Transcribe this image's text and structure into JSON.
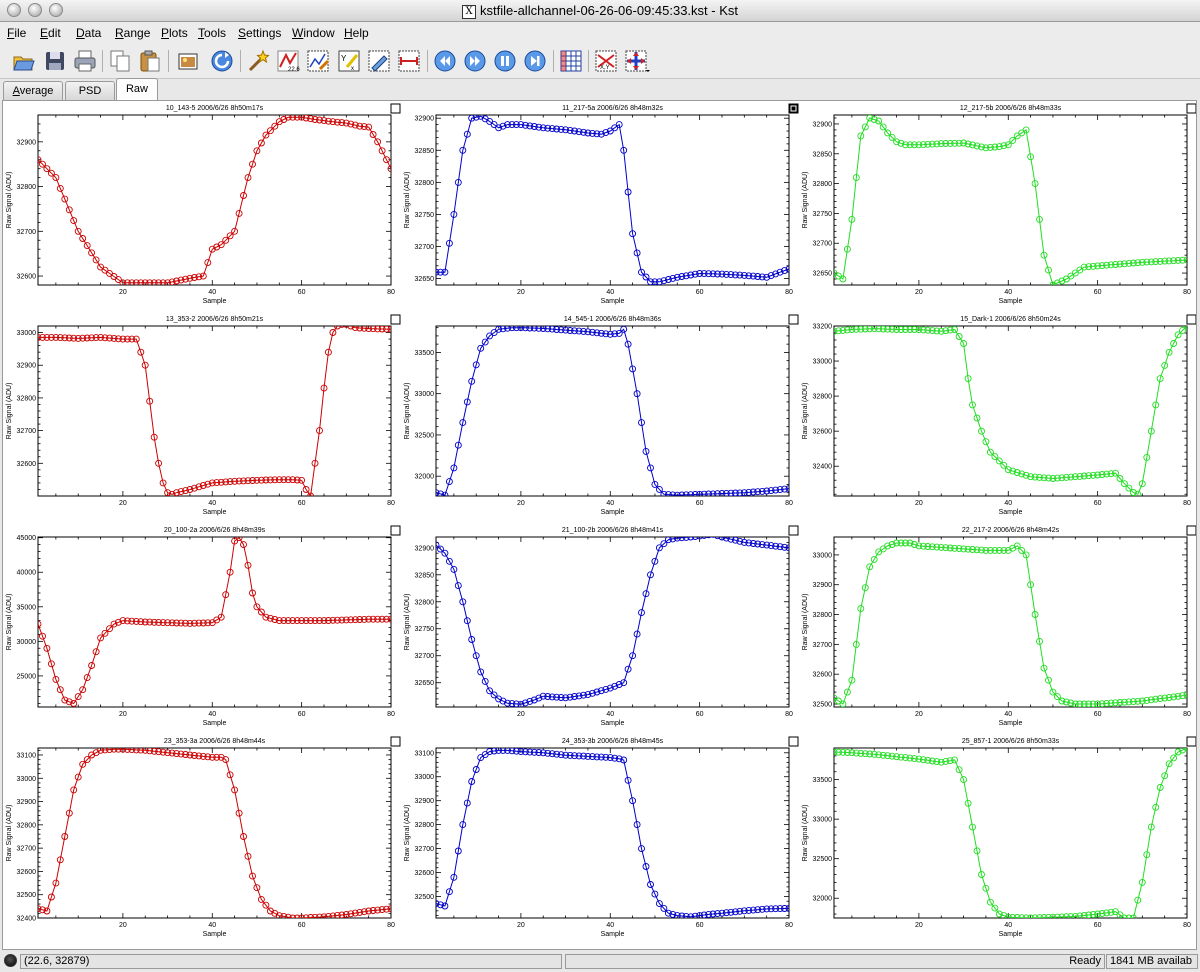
{
  "window": {
    "title": "kstfile-allchannel-06-26-06-09:45:33.kst - Kst"
  },
  "menu": [
    "File",
    "Edit",
    "Data",
    "Range",
    "Plots",
    "Tools",
    "Settings",
    "Window",
    "Help"
  ],
  "toolbar_icons": [
    "open-icon",
    "save-icon",
    "print-icon",
    "copy-icon",
    "paste-icon",
    "export-image-icon",
    "reload-icon",
    "data-wizard-icon",
    "plugin-icon",
    "edit-plot-icon",
    "equation-icon",
    "histogram-icon",
    "spectrum-icon",
    "back-icon",
    "forward-icon",
    "pause-icon",
    "end-icon",
    "grid-layout-icon",
    "xy-zoom-icon",
    "layout-mode-icon"
  ],
  "tabs": [
    "Average",
    "PSD",
    "Raw"
  ],
  "active_tab": "Raw",
  "status": {
    "coords": "(22.6, 32879)",
    "state": "Ready",
    "memory": "1841 MB availab"
  },
  "colors": {
    "red": "#cc0000",
    "blue": "#0000cc",
    "green": "#22dd22"
  },
  "chart_data": [
    {
      "type": "line",
      "title": "10_143-5 2006/6/26 8h50m17s",
      "xlabel": "Sample",
      "ylabel": "Raw Signal (ADU)",
      "color": "red",
      "xlim": [
        1,
        80
      ],
      "ylim": [
        32580,
        32960
      ],
      "yticks": [
        32600,
        32700,
        32800,
        32900
      ],
      "xticks": [
        20,
        40,
        60,
        80
      ],
      "checked": false,
      "x": [
        1,
        5,
        10,
        15,
        20,
        25,
        30,
        35,
        38,
        40,
        42,
        45,
        48,
        50,
        52,
        55,
        57,
        60,
        63,
        67,
        70,
        73,
        75,
        77,
        78,
        80
      ],
      "y": [
        32860,
        32820,
        32700,
        32620,
        32585,
        32585,
        32585,
        32595,
        32600,
        32660,
        32670,
        32700,
        32820,
        32880,
        32915,
        32945,
        32955,
        32955,
        32950,
        32945,
        32942,
        32935,
        32933,
        32900,
        32880,
        32840
      ]
    },
    {
      "type": "line",
      "title": "11_217-5a 2006/6/26 8h48m32s",
      "xlabel": "Sample",
      "ylabel": "Raw Signal (ADU)",
      "color": "blue",
      "xlim": [
        1,
        80
      ],
      "ylim": [
        32640,
        32905
      ],
      "yticks": [
        32650,
        32700,
        32750,
        32800,
        32850,
        32900
      ],
      "xticks": [
        20,
        40,
        60,
        80
      ],
      "checked": true,
      "x": [
        1,
        3,
        5,
        7,
        9,
        11,
        13,
        15,
        17,
        20,
        25,
        30,
        35,
        38,
        40,
        42,
        43,
        45,
        47,
        49,
        51,
        55,
        60,
        65,
        70,
        75,
        78,
        80
      ],
      "y": [
        32660,
        32660,
        32750,
        32850,
        32900,
        32903,
        32895,
        32885,
        32890,
        32890,
        32885,
        32882,
        32877,
        32875,
        32880,
        32890,
        32850,
        32720,
        32660,
        32645,
        32645,
        32652,
        32658,
        32657,
        32655,
        32652,
        32660,
        32665
      ]
    },
    {
      "type": "line",
      "title": "12_217-5b 2006/6/26 8h48m33s",
      "xlabel": "Sample",
      "ylabel": "Raw Signal (ADU)",
      "color": "green",
      "xlim": [
        1,
        80
      ],
      "ylim": [
        32630,
        32915
      ],
      "yticks": [
        32650,
        32700,
        32750,
        32800,
        32850,
        32900
      ],
      "xticks": [
        20,
        40,
        60,
        80
      ],
      "checked": false,
      "x": [
        1,
        3,
        5,
        7,
        9,
        11,
        13,
        15,
        17,
        20,
        25,
        30,
        35,
        38,
        40,
        42,
        44,
        46,
        48,
        50,
        53,
        57,
        60,
        65,
        70,
        75,
        80
      ],
      "y": [
        32650,
        32640,
        32740,
        32880,
        32910,
        32905,
        32885,
        32870,
        32865,
        32865,
        32867,
        32868,
        32860,
        32862,
        32865,
        32880,
        32890,
        32800,
        32680,
        32630,
        32640,
        32660,
        32662,
        32665,
        32668,
        32670,
        32672
      ]
    },
    {
      "type": "line",
      "title": "13_353-2 2006/6/26 8h50m21s",
      "xlabel": "Sample",
      "ylabel": "Raw Signal (ADU)",
      "color": "red",
      "xlim": [
        1,
        80
      ],
      "ylim": [
        32500,
        33020
      ],
      "yticks": [
        32600,
        32700,
        32800,
        32900,
        33000
      ],
      "xticks": [
        20,
        40,
        60,
        80
      ],
      "checked": false,
      "x": [
        1,
        5,
        10,
        15,
        20,
        23,
        25,
        26,
        27,
        28,
        29,
        30,
        31,
        32,
        35,
        40,
        45,
        50,
        55,
        58,
        60,
        61,
        62,
        63,
        64,
        65,
        66,
        67,
        68,
        69,
        70,
        72,
        75,
        80
      ],
      "y": [
        32985,
        32985,
        32982,
        32985,
        32980,
        32980,
        32900,
        32790,
        32680,
        32600,
        32540,
        32510,
        32505,
        32510,
        32520,
        32540,
        32545,
        32548,
        32550,
        32550,
        32548,
        32520,
        32500,
        32600,
        32700,
        32830,
        32940,
        33000,
        33020,
        33025,
        33025,
        33015,
        33012,
        33010
      ]
    },
    {
      "type": "line",
      "title": "14_545-1 2006/6/26 8h48m36s",
      "xlabel": "Sample",
      "ylabel": "Raw Signal (ADU)",
      "color": "blue",
      "xlim": [
        1,
        80
      ],
      "ylim": [
        31760,
        33820
      ],
      "yticks": [
        32000,
        32500,
        33000,
        33500
      ],
      "xticks": [
        20,
        40,
        60,
        80
      ],
      "checked": false,
      "x": [
        1,
        3,
        5,
        7,
        9,
        11,
        13,
        15,
        18,
        20,
        25,
        30,
        35,
        40,
        42,
        43,
        44,
        46,
        48,
        50,
        52,
        55,
        60,
        65,
        70,
        75,
        80
      ],
      "y": [
        31800,
        31770,
        32100,
        32650,
        33150,
        33550,
        33700,
        33780,
        33800,
        33800,
        33790,
        33770,
        33750,
        33720,
        33730,
        33780,
        33600,
        33000,
        32300,
        31900,
        31780,
        31770,
        31780,
        31790,
        31800,
        31820,
        31850
      ]
    },
    {
      "type": "line",
      "title": "15_Dark-1 2006/6/26 8h50m24s",
      "xlabel": "Sample",
      "ylabel": "Raw Signal (ADU)",
      "color": "green",
      "xlim": [
        1,
        80
      ],
      "ylim": [
        32230,
        33200
      ],
      "yticks": [
        32400,
        32600,
        32800,
        33000,
        33200
      ],
      "xticks": [
        20,
        40,
        60,
        80
      ],
      "checked": false,
      "x": [
        1,
        5,
        10,
        15,
        20,
        25,
        28,
        30,
        31,
        32,
        34,
        36,
        40,
        45,
        50,
        55,
        60,
        64,
        66,
        68,
        69,
        70,
        72,
        74,
        76,
        78,
        80
      ],
      "y": [
        33170,
        33180,
        33185,
        33180,
        33180,
        33170,
        33180,
        33100,
        32900,
        32750,
        32600,
        32480,
        32380,
        32340,
        32330,
        32340,
        32350,
        32360,
        32300,
        32250,
        32240,
        32300,
        32600,
        32900,
        33050,
        33150,
        33200
      ]
    },
    {
      "type": "line",
      "title": "20_100-2a 2006/6/26 8h48m39s",
      "xlabel": "Sample",
      "ylabel": "Raw Signal (ADU)",
      "color": "red",
      "xlim": [
        1,
        80
      ],
      "ylim": [
        20500,
        45100
      ],
      "yticks": [
        25000,
        30000,
        35000,
        40000,
        45000
      ],
      "xticks": [
        20,
        40,
        60,
        80
      ],
      "checked": false,
      "x": [
        1,
        3,
        5,
        7,
        9,
        11,
        13,
        15,
        18,
        20,
        25,
        30,
        35,
        40,
        42,
        44,
        45,
        46,
        47,
        48,
        49,
        50,
        52,
        55,
        60,
        65,
        70,
        75,
        80
      ],
      "y": [
        32500,
        29000,
        24500,
        21500,
        21000,
        23000,
        26500,
        30500,
        32500,
        33000,
        32800,
        32700,
        32600,
        32700,
        33500,
        40000,
        44500,
        45000,
        44000,
        41000,
        37000,
        35000,
        33500,
        33000,
        33000,
        33000,
        33100,
        33200,
        33200
      ]
    },
    {
      "type": "line",
      "title": "21_100-2b 2006/6/26 8h48m41s",
      "xlabel": "Sample",
      "ylabel": "Raw Signal (ADU)",
      "color": "blue",
      "xlim": [
        1,
        80
      ],
      "ylim": [
        32605,
        32920
      ],
      "yticks": [
        32650,
        32700,
        32750,
        32800,
        32850,
        32900
      ],
      "xticks": [
        20,
        40,
        60,
        80
      ],
      "checked": false,
      "x": [
        1,
        3,
        5,
        7,
        9,
        11,
        13,
        15,
        17,
        20,
        23,
        25,
        30,
        35,
        40,
        43,
        45,
        47,
        49,
        51,
        53,
        55,
        58,
        60,
        63,
        65,
        70,
        75,
        80
      ],
      "y": [
        32905,
        32890,
        32860,
        32800,
        32730,
        32670,
        32635,
        32620,
        32612,
        32610,
        32618,
        32625,
        32622,
        32628,
        32640,
        32650,
        32700,
        32780,
        32850,
        32900,
        32915,
        32918,
        32920,
        32922,
        32925,
        32920,
        32910,
        32905,
        32900
      ]
    },
    {
      "type": "line",
      "title": "22_217-2 2006/6/26 8h48m42s",
      "xlabel": "Sample",
      "ylabel": "Raw Signal (ADU)",
      "color": "green",
      "xlim": [
        1,
        80
      ],
      "ylim": [
        32490,
        33060
      ],
      "yticks": [
        32500,
        32600,
        32700,
        32800,
        32900,
        33000
      ],
      "xticks": [
        20,
        40,
        60,
        80
      ],
      "checked": false,
      "x": [
        1,
        3,
        5,
        7,
        9,
        11,
        13,
        15,
        18,
        20,
        25,
        30,
        35,
        40,
        42,
        44,
        46,
        48,
        50,
        52,
        55,
        60,
        65,
        70,
        75,
        80
      ],
      "y": [
        32520,
        32500,
        32580,
        32820,
        32960,
        33010,
        33030,
        33040,
        33040,
        33030,
        33025,
        33020,
        33015,
        33015,
        33030,
        33000,
        32800,
        32620,
        32540,
        32510,
        32500,
        32500,
        32505,
        32510,
        32520,
        32530
      ]
    },
    {
      "type": "line",
      "title": "23_353-3a 2006/6/26 8h48m44s",
      "xlabel": "Sample",
      "ylabel": "Raw Signal (ADU)",
      "color": "red",
      "xlim": [
        1,
        80
      ],
      "ylim": [
        32400,
        33130
      ],
      "yticks": [
        32400,
        32500,
        32600,
        32700,
        32800,
        32900,
        33000,
        33100
      ],
      "xticks": [
        20,
        40,
        60,
        80
      ],
      "checked": false,
      "x": [
        1,
        3,
        5,
        7,
        9,
        11,
        13,
        15,
        18,
        20,
        25,
        30,
        35,
        40,
        42,
        43,
        45,
        47,
        49,
        51,
        53,
        55,
        58,
        60,
        65,
        70,
        75,
        80
      ],
      "y": [
        32440,
        32430,
        32550,
        32750,
        32950,
        33060,
        33100,
        33120,
        33125,
        33125,
        33120,
        33110,
        33100,
        33090,
        33090,
        33080,
        32950,
        32750,
        32580,
        32480,
        32430,
        32410,
        32400,
        32400,
        32405,
        32415,
        32430,
        32440
      ]
    },
    {
      "type": "line",
      "title": "24_353-3b 2006/6/26 8h48m45s",
      "xlabel": "Sample",
      "ylabel": "Raw Signal (ADU)",
      "color": "blue",
      "xlim": [
        1,
        80
      ],
      "ylim": [
        32410,
        33120
      ],
      "yticks": [
        32500,
        32600,
        32700,
        32800,
        32900,
        33000,
        33100
      ],
      "xticks": [
        20,
        40,
        60,
        80
      ],
      "checked": false,
      "x": [
        1,
        3,
        5,
        7,
        9,
        11,
        13,
        15,
        17,
        20,
        25,
        30,
        35,
        40,
        42,
        43,
        45,
        47,
        49,
        51,
        53,
        55,
        58,
        60,
        62,
        65,
        70,
        75,
        80
      ],
      "y": [
        32470,
        32460,
        32580,
        32800,
        32980,
        33080,
        33105,
        33110,
        33110,
        33105,
        33100,
        33090,
        33085,
        33080,
        33075,
        33070,
        32900,
        32700,
        32550,
        32470,
        32430,
        32420,
        32415,
        32420,
        32425,
        32430,
        32440,
        32448,
        32450
      ]
    },
    {
      "type": "line",
      "title": "25_857-1 2006/6/26 8h50m33s",
      "xlabel": "Sample",
      "ylabel": "Raw Signal (ADU)",
      "color": "green",
      "xlim": [
        1,
        80
      ],
      "ylim": [
        31750,
        33900
      ],
      "yticks": [
        32000,
        32500,
        33000,
        33500
      ],
      "xticks": [
        20,
        40,
        60,
        80
      ],
      "checked": false,
      "x": [
        1,
        5,
        10,
        15,
        20,
        25,
        28,
        30,
        32,
        34,
        36,
        38,
        40,
        45,
        50,
        55,
        60,
        64,
        66,
        68,
        70,
        72,
        74,
        76,
        78,
        80
      ],
      "y": [
        33850,
        33840,
        33820,
        33790,
        33760,
        33720,
        33750,
        33500,
        32900,
        32300,
        31950,
        31800,
        31760,
        31750,
        31760,
        31770,
        31800,
        31830,
        31750,
        31750,
        32200,
        32900,
        33400,
        33700,
        33850,
        33900
      ]
    }
  ]
}
